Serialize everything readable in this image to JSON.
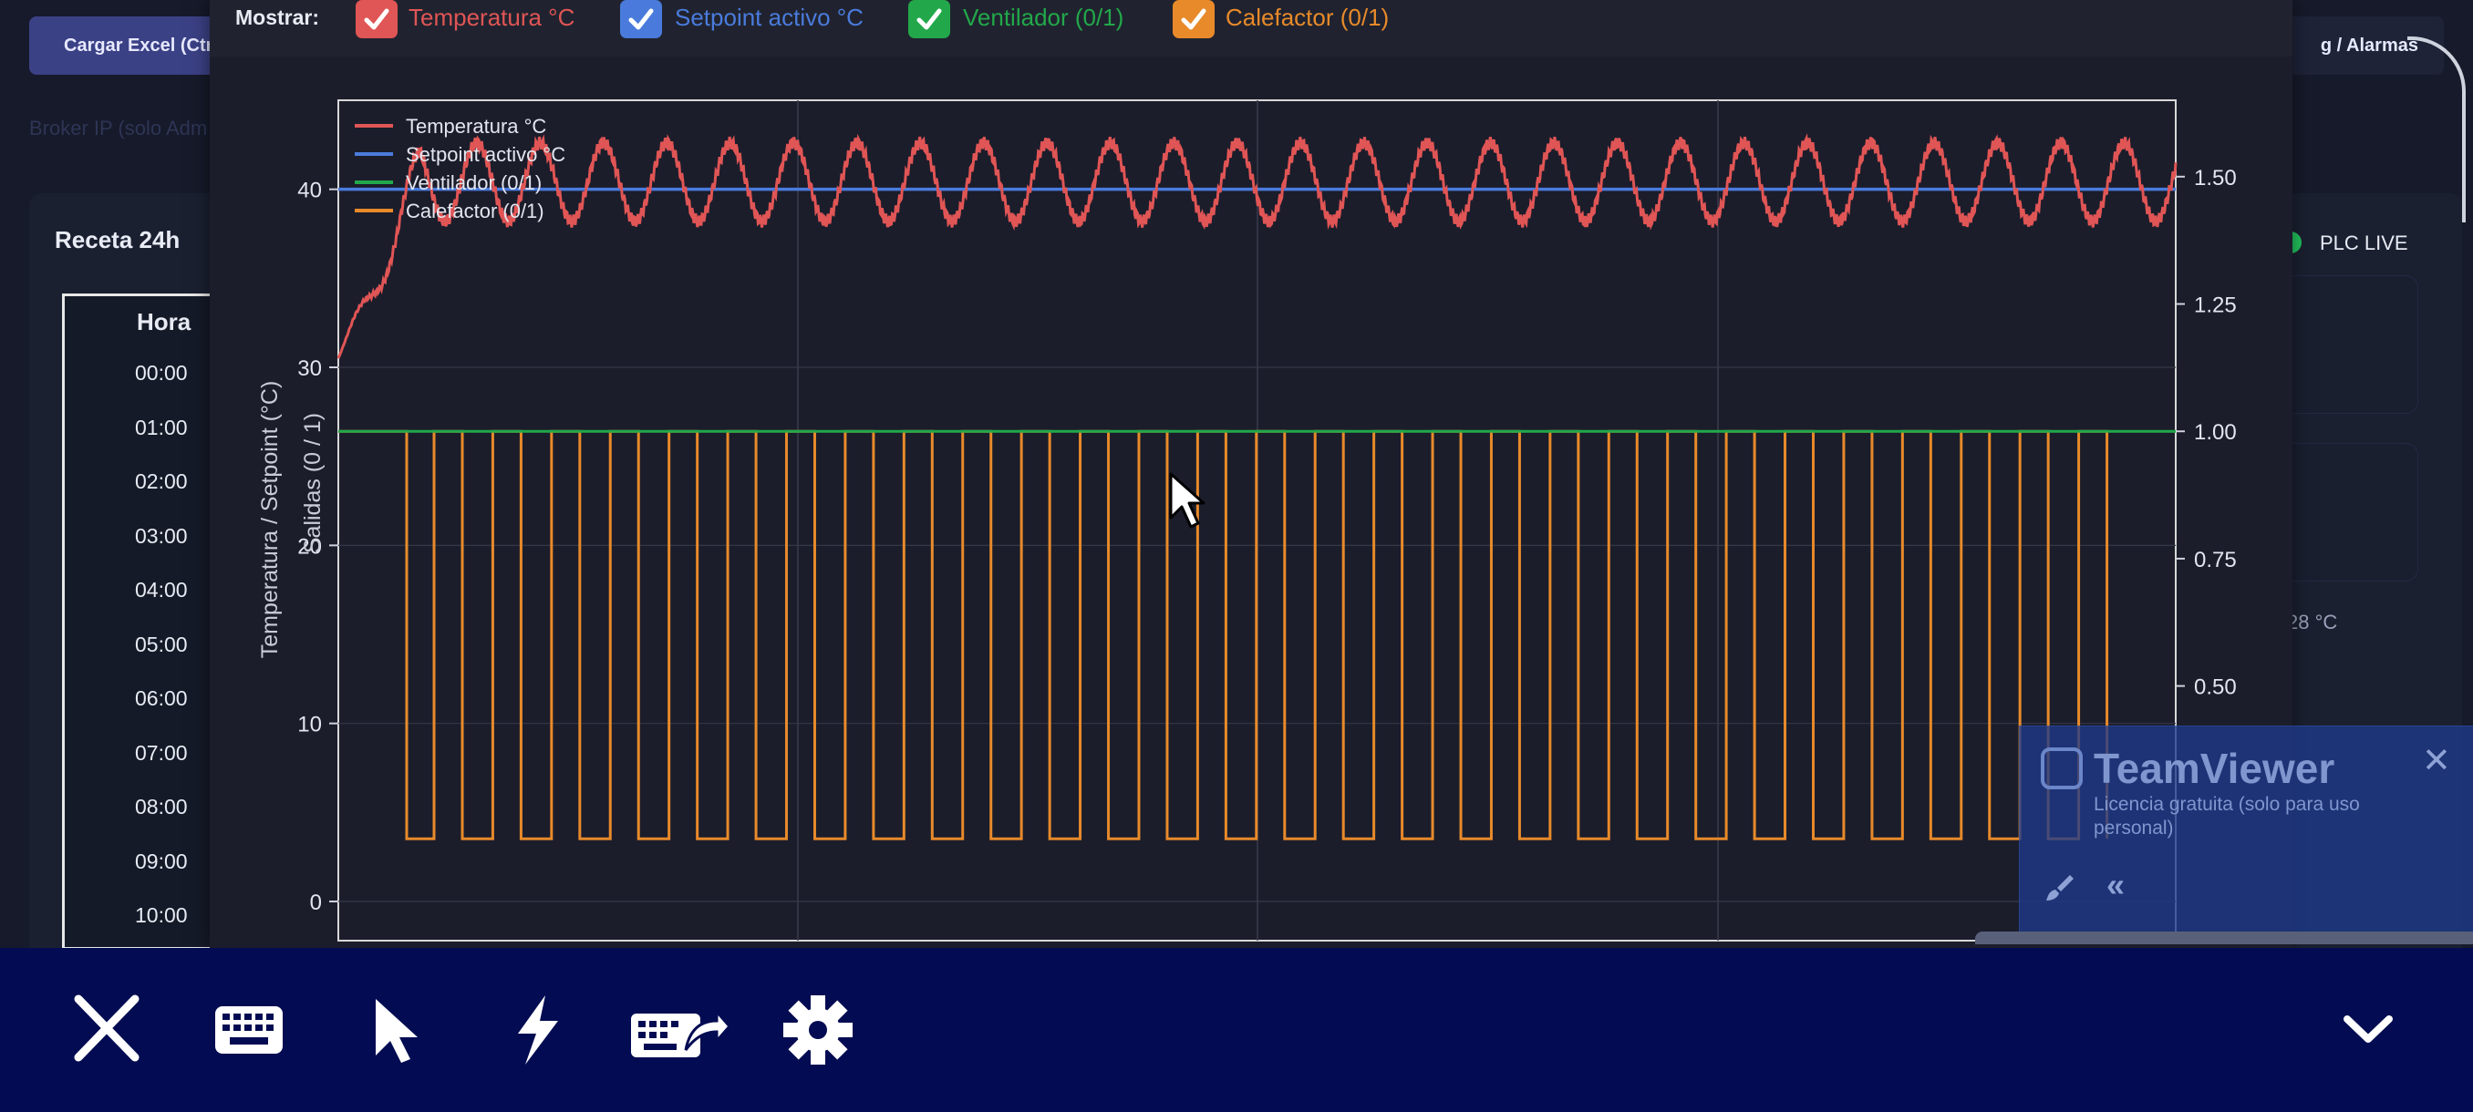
{
  "background_app": {
    "load_excel_label": "Cargar Excel (Ctrl",
    "log_alarms_label": "g / Alarmas",
    "broker_label": "Broker IP (solo Adm",
    "recipe_title": "Receta 24h",
    "hour_header": "Hora",
    "hours": [
      "00:00",
      "01:00",
      "02:00",
      "03:00",
      "04:00",
      "05:00",
      "06:00",
      "07:00",
      "08:00",
      "09:00",
      "10:00"
    ],
    "plc_status": "PLC LIVE",
    "temp_partial": "28 °C"
  },
  "chart_window": {
    "show_label": "Mostrar:",
    "toggles": [
      {
        "label": "Temperatura °C",
        "color": "#e05555",
        "checked": true
      },
      {
        "label": "Setpoint activo °C",
        "color": "#4a7bdc",
        "checked": true
      },
      {
        "label": "Ventilador (0/1)",
        "color": "#22a84a",
        "checked": true
      },
      {
        "label": "Calefactor (0/1)",
        "color": "#e88a2a",
        "checked": true
      }
    ]
  },
  "chart_data": {
    "type": "line",
    "title": "",
    "ylabel": "Temperatura / Setpoint (°C)",
    "y2label": "Salidas (0 / 1)",
    "ylim": [
      -2.2,
      45
    ],
    "y2lim": [
      0.0,
      1.65
    ],
    "yticks": [
      "0",
      "10",
      "20",
      "30",
      "40"
    ],
    "y2ticks": [
      "0.50",
      "0.75",
      "1.00",
      "1.25",
      "1.50"
    ],
    "legend_position": "top-left",
    "grid": true,
    "legend": [
      "Temperatura °C",
      "Setpoint activo °C",
      "Ventilador (0/1)",
      "Calefactor (0/1)"
    ],
    "series": [
      {
        "name": "Temperatura °C",
        "color": "#e05555",
        "description_values": {
          "start": 30.5,
          "mean": 40.4,
          "amplitude": 2.2,
          "cycles": 29
        }
      },
      {
        "name": "Setpoint activo °C",
        "color": "#4a7bdc",
        "values": [
          40,
          40
        ]
      },
      {
        "name": "Ventilador (0/1)",
        "color": "#22a84a",
        "values": [
          1,
          1
        ]
      },
      {
        "name": "Calefactor (0/1)",
        "color": "#e88a2a",
        "low_value": 0.2,
        "high_value": 1,
        "pulses": 29
      }
    ]
  },
  "teamviewer": {
    "title": "TeamViewer",
    "subtitle": "Licencia gratuita (solo para uso personal)",
    "close": "✕",
    "collapse": "«"
  },
  "toolbar": {
    "icons": [
      "close-icon",
      "keyboard-icon",
      "pointer-icon",
      "lightning-icon",
      "keyboard-shortcut-icon",
      "settings-icon"
    ],
    "expand_icon": "chevron-down-icon"
  }
}
